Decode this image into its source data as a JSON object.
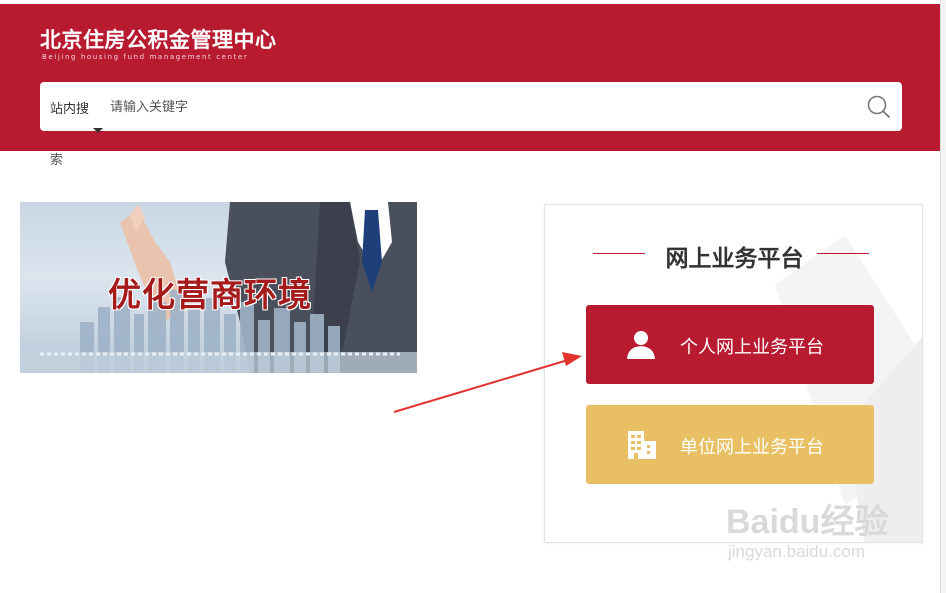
{
  "header": {
    "title": "北京住房公积金管理中心",
    "subtitle": "Beijing housing fund management center",
    "brand_color": "#b81a30"
  },
  "search": {
    "scope_label": "站内搜",
    "scope_label_overflow": "索",
    "placeholder": "请输入关键字",
    "icon": "search-icon"
  },
  "banner": {
    "text": "优化营商环境"
  },
  "platform": {
    "title": "网上业务平台",
    "buttons": [
      {
        "label": "个人网上业务平台",
        "icon": "person-icon",
        "color": "#b81a30"
      },
      {
        "label": "单位网上业务平台",
        "icon": "building-icon",
        "color": "#e8c063"
      }
    ]
  },
  "watermark": {
    "logo_text": "Baidu经验",
    "url": "jingyan.baidu.com"
  }
}
